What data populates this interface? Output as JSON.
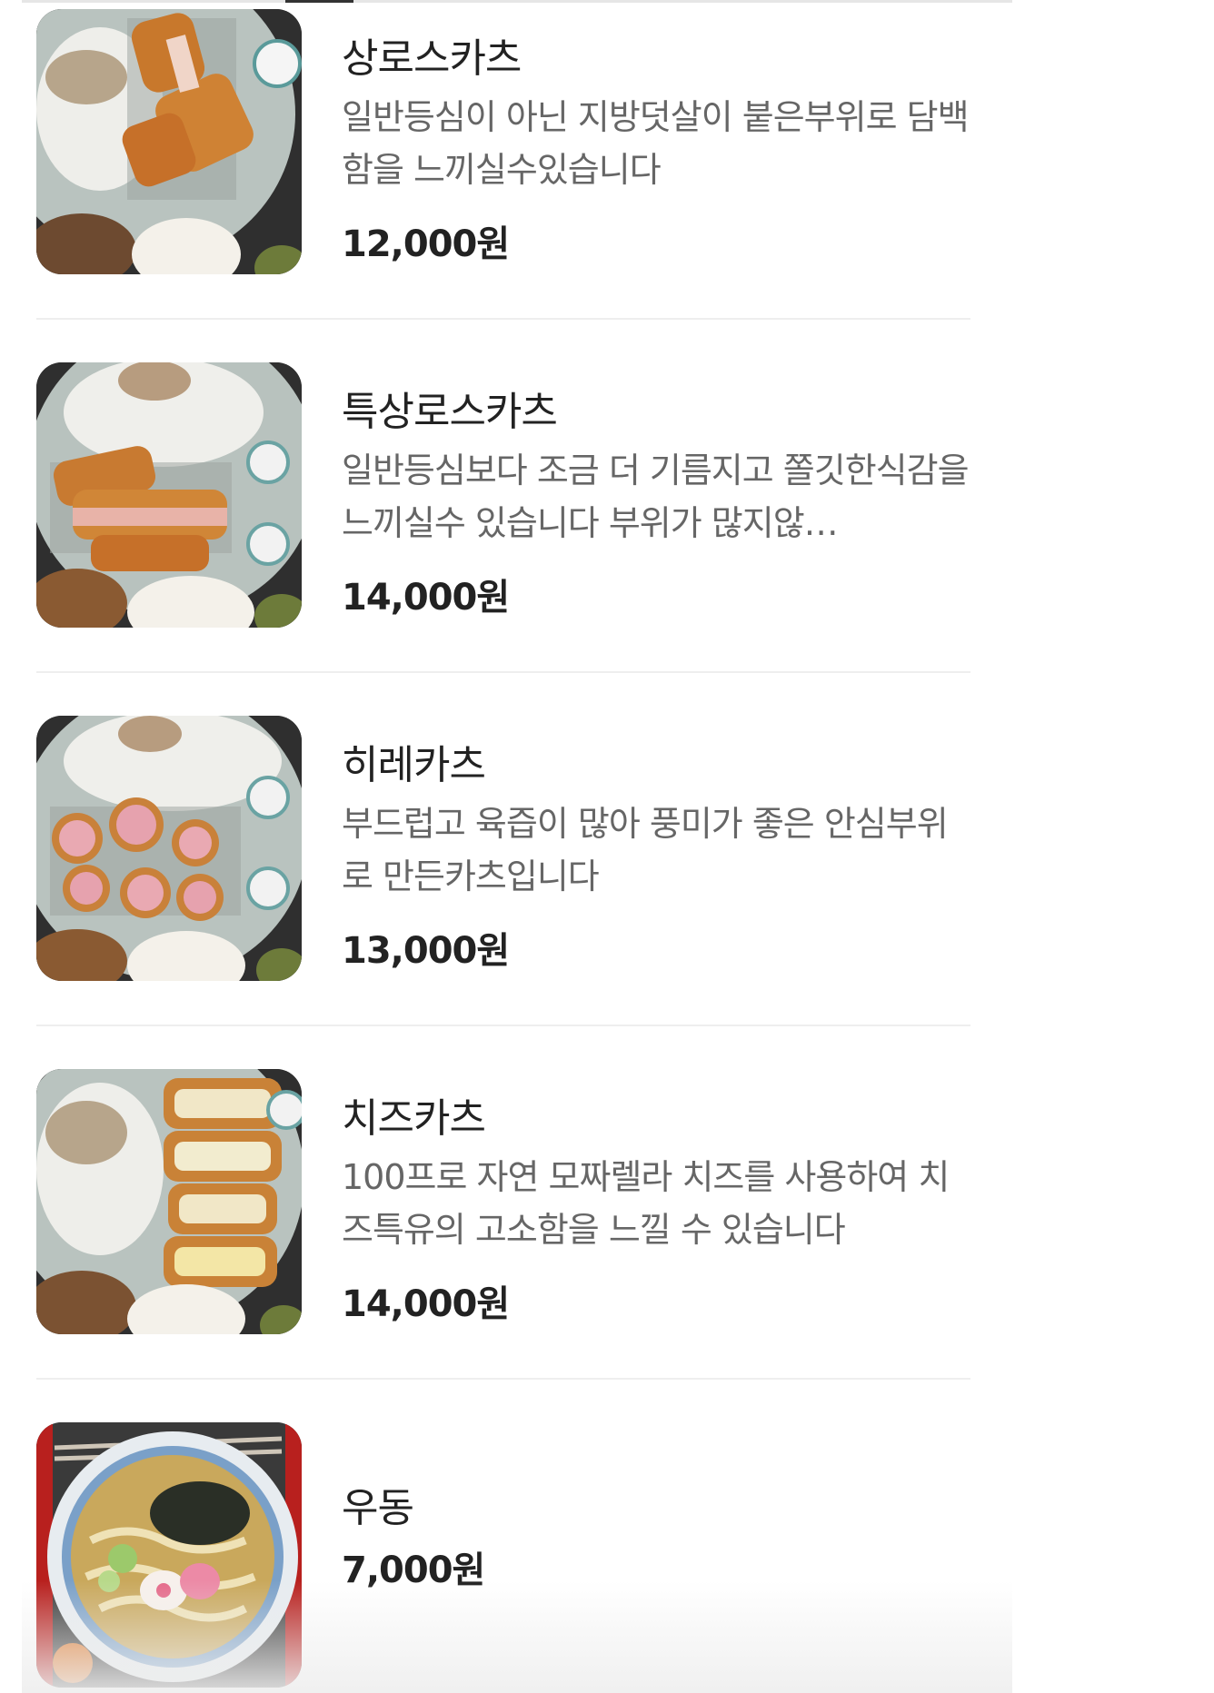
{
  "menu": {
    "items": [
      {
        "name": "상로스카츠",
        "description": "일반등심이 아닌 지방덧살이 붙은부위로 담백함을 느끼실수있습니다",
        "price": "12,000원",
        "photo_icon": "pork-cutlet-photo-icon"
      },
      {
        "name": "특상로스카츠",
        "description": "일반등심보다 조금 더 기름지고 쫄깃한식감을 느끼실수 있습니다 부위가 많지않…",
        "price": "14,000원",
        "photo_icon": "premium-pork-cutlet-photo-icon"
      },
      {
        "name": "히레카츠",
        "description": "부드럽고 육즙이 많아 풍미가 좋은 안심부위로 만든카츠입니다",
        "price": "13,000원",
        "photo_icon": "tenderloin-cutlet-photo-icon"
      },
      {
        "name": "치즈카츠",
        "description": "100프로 자연 모짜렐라 치즈를 사용하여 치즈특유의 고소함을 느낄 수 있습니다",
        "price": "14,000원",
        "photo_icon": "cheese-cutlet-photo-icon"
      },
      {
        "name": "우동",
        "description": "",
        "price": "7,000원",
        "photo_icon": "udon-photo-icon"
      }
    ]
  },
  "colors": {
    "title_text": "#222222",
    "description_text": "#666666",
    "divider": "#eeeeee",
    "background": "#ffffff"
  }
}
